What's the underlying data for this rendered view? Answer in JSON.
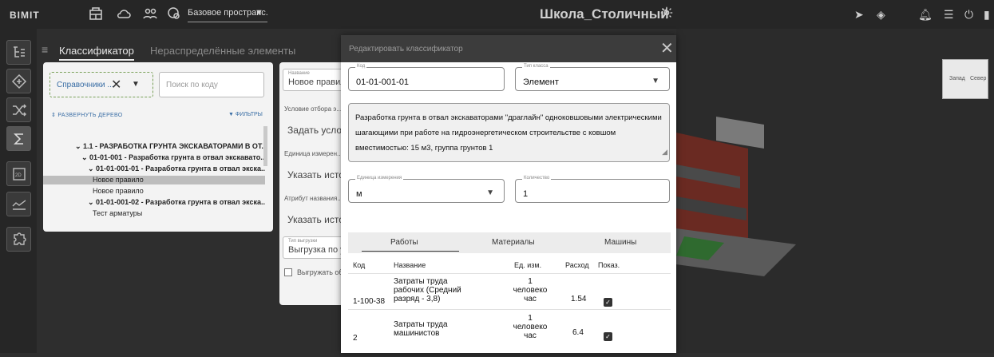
{
  "app": {
    "logo": "BIMIT",
    "space_select": "Базовое пространс...",
    "project_title": "Школа_Столичный"
  },
  "left_panel": {
    "tabs": [
      "Классификатор",
      "Нераспределённые элементы"
    ],
    "filter_chip": "Справочники ...",
    "search_placeholder": "Поиск по коду",
    "expand_tree": "РАЗВЕРНУТЬ ДЕРЕВО",
    "filters": "ФИЛЬТРЫ",
    "tree": [
      {
        "label": "1.1 - РАЗРАБОТКА ГРУНТА ЭКСКАВАТОРАМИ В ОТ...",
        "level": 1,
        "bold": true,
        "selected": false
      },
      {
        "label": "01-01-001 - Разработка грунта в отвал экскавато...",
        "level": 2,
        "bold": true,
        "selected": false
      },
      {
        "label": "01-01-001-01 - Разработка грунта в отвал экска...",
        "level": 3,
        "bold": true,
        "selected": false
      },
      {
        "label": "Новое правило",
        "level": 4,
        "bold": false,
        "selected": true
      },
      {
        "label": "Новое правило",
        "level": 4,
        "bold": false,
        "selected": false
      },
      {
        "label": "01-01-001-02 - Разработка грунта в отвал экска...",
        "level": 3,
        "bold": true,
        "selected": false
      },
      {
        "label": "Тест арматуры",
        "level": 4,
        "bold": false,
        "selected": false
      }
    ]
  },
  "rule_panel": {
    "name_label": "Название",
    "name_value": "Новое правило",
    "condition_label": "Условие отбора э...",
    "condition_value": "Задать услови...",
    "unit_label": "Единица измерен...",
    "unit_value": "Указать источ...",
    "attr_label": "Атрибут названия...",
    "attr_value": "Указать источ...",
    "export_type_label": "Тип выгрузки",
    "export_type_value": "Выгрузка по у...",
    "export_check_label": "Выгружать об..."
  },
  "modal": {
    "title": "Редактировать классификатор",
    "code_label": "Код",
    "code_value": "01-01-001-01",
    "class_type_label": "Тип класса",
    "class_type_value": "Элемент",
    "description_lines": [
      "Разработка грунта в отвал экскаваторами \"драглайн\" одноковшовыми электрическими",
      "шагающими при работе на гидроэнергетическом строительстве с ковшом",
      "вместимостью: 15 м3, группа грунтов 1"
    ],
    "unit_label": "Единица измерения",
    "unit_value": "м",
    "quantity_label": "Количество",
    "quantity_value": "1",
    "tabs": [
      "Работы",
      "Материалы",
      "Машины"
    ],
    "active_tab": "Работы",
    "table_headers": [
      "Код",
      "Название",
      "Ед. изм.",
      "Расход",
      "Показ."
    ],
    "rows": [
      {
        "code": "1-100-38",
        "name": [
          "Затраты труда",
          "рабочих (Средний",
          "разряд - 3,8)"
        ],
        "unit": [
          "1",
          "человеко",
          "час"
        ],
        "rate": "1.54",
        "show": true
      },
      {
        "code": "2",
        "name": [
          "Затраты труда",
          "машинистов"
        ],
        "unit": [
          "1",
          "человеко",
          "час"
        ],
        "rate": "6.4",
        "show": true
      }
    ]
  },
  "scene": {
    "cube_faces": [
      "Запад",
      "Север"
    ]
  }
}
